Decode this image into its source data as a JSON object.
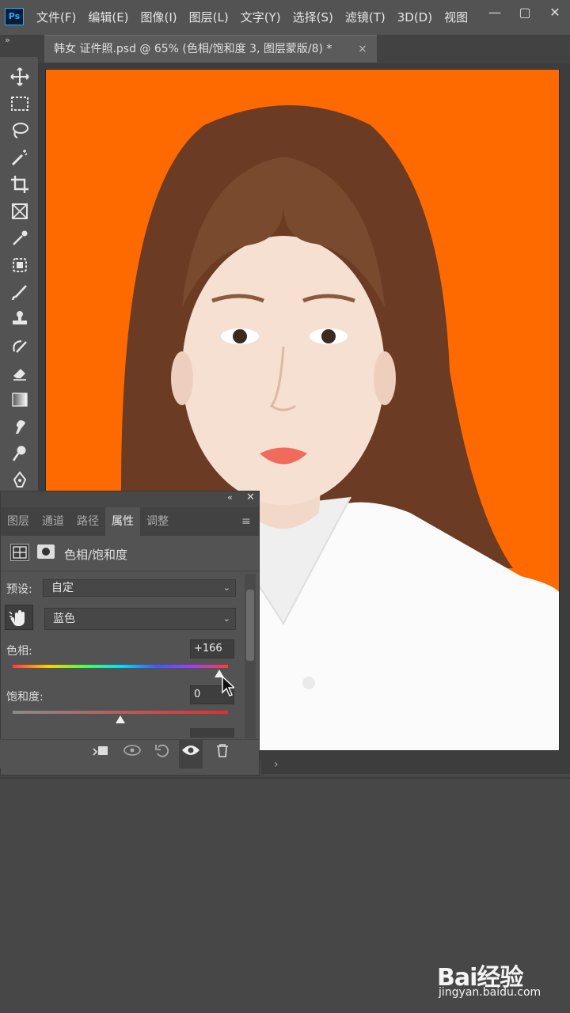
{
  "app": {
    "logo": "Ps",
    "menu": [
      "文件(F)",
      "编辑(E)",
      "图像(I)",
      "图层(L)",
      "文字(Y)",
      "选择(S)",
      "滤镜(T)",
      "3D(D)",
      "视图"
    ],
    "window_controls": {
      "minimize": "—",
      "restore": "▢",
      "close": "✕"
    }
  },
  "document": {
    "tab_title": "韩女 证件照.psd @ 65% (色相/饱和度 3, 图层蒙版/8) *",
    "tab_close": "×",
    "background_color": "#ff6a00"
  },
  "toolbar": {
    "collapse": "»",
    "tools": [
      "move-tool",
      "marquee-tool",
      "lasso-tool",
      "magic-wand-tool",
      "crop-tool",
      "frame-tool",
      "eyedropper-tool",
      "healing-tool",
      "brush-tool",
      "stamp-tool",
      "history-brush-tool",
      "eraser-tool",
      "gradient-tool",
      "smudge-tool",
      "dodge-tool",
      "pen-tool"
    ]
  },
  "panel": {
    "collapse": "«",
    "close": "✕",
    "tabs": [
      "图层",
      "通道",
      "路径",
      "属性",
      "调整"
    ],
    "active_tab": "属性",
    "menu_icon": "≡",
    "adjustment_title": "色相/饱和度",
    "preset_label": "预设:",
    "preset_value": "自定",
    "channel_value": "蓝色",
    "hue_label": "色相:",
    "hue_value": "+166",
    "hue_fraction": 0.96,
    "saturation_label": "饱和度:",
    "saturation_value": "0",
    "saturation_fraction": 0.5,
    "bottom_buttons": [
      "clip-to-layer",
      "view-previous",
      "reset",
      "visibility",
      "delete"
    ]
  },
  "scroll_arrow": "›",
  "watermark": {
    "logo": "Bai经验",
    "url": "jingyan.baidu.com"
  }
}
